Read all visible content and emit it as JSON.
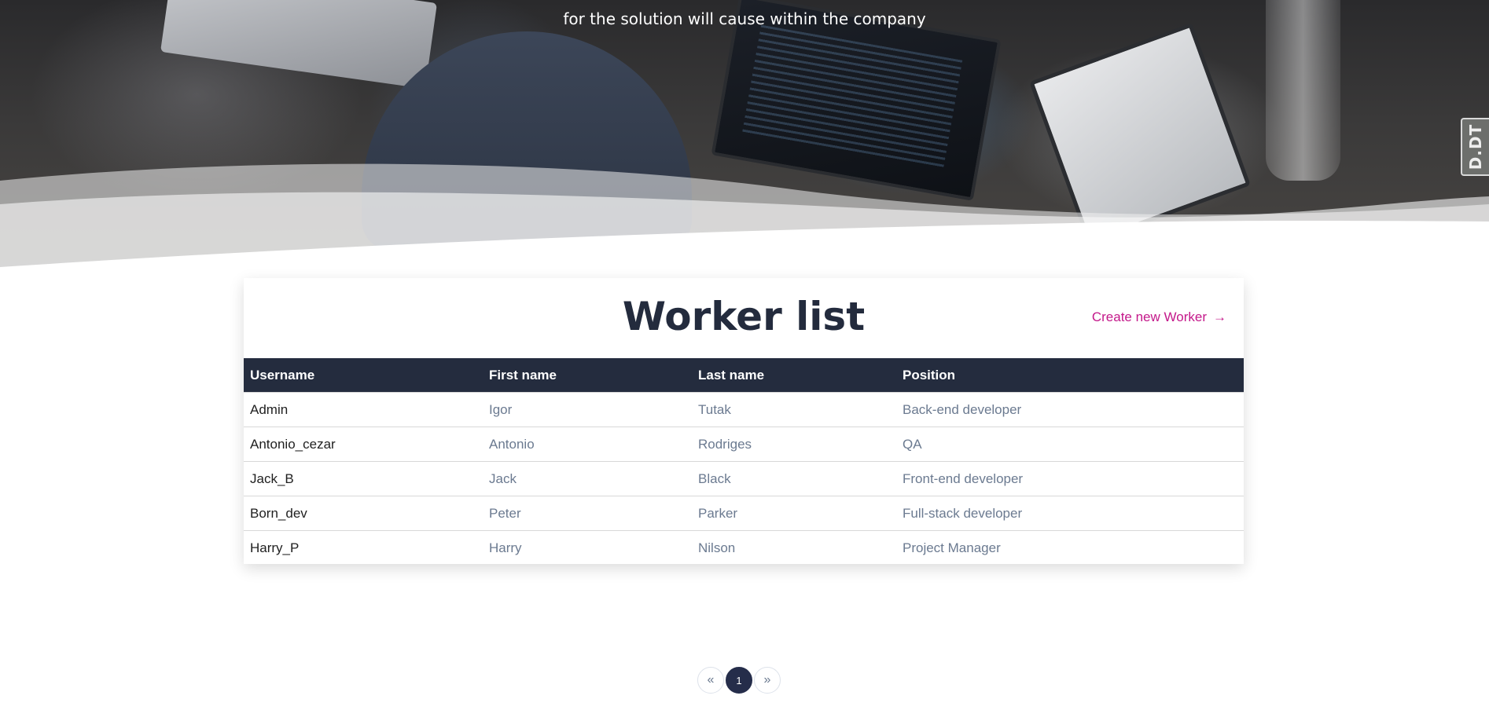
{
  "hero": {
    "subtitle": "for the solution will cause within the company",
    "badge": "D.DT"
  },
  "card": {
    "title": "Worker list",
    "create_link": "Create new Worker",
    "arrow_icon": "arrow-right-icon"
  },
  "table": {
    "headers": [
      "Username",
      "First name",
      "Last name",
      "Position"
    ],
    "rows": [
      [
        "Admin",
        "Igor",
        "Tutak",
        "Back-end developer"
      ],
      [
        "Antonio_cezar",
        "Antonio",
        "Rodriges",
        "QA"
      ],
      [
        "Jack_B",
        "Jack",
        "Black",
        "Front-end developer"
      ],
      [
        "Born_dev",
        "Peter",
        "Parker",
        "Full-stack developer"
      ],
      [
        "Harry_P",
        "Harry",
        "Nilson",
        "Project Manager"
      ]
    ]
  },
  "pagination": {
    "prev": "«",
    "current": "1",
    "next": "»"
  },
  "colors": {
    "header_bg": "#242c3e",
    "title": "#232b3d",
    "accent_link": "#c4188a",
    "active_page": "#252d4a"
  }
}
